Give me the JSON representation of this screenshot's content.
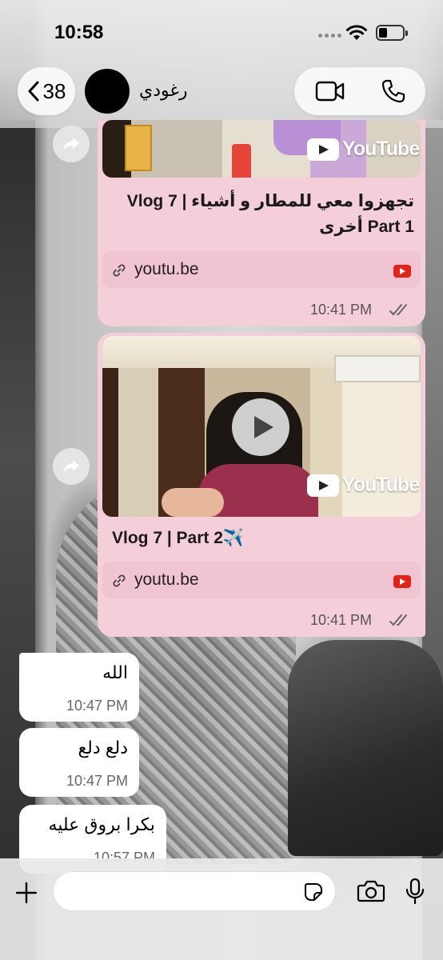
{
  "status_bar": {
    "time": "10:58"
  },
  "header": {
    "back_count": "38",
    "contact_name": "رغودي",
    "video_call_icon": "video-camera-icon",
    "voice_call_icon": "phone-icon"
  },
  "messages": [
    {
      "type": "youtube_link",
      "direction": "outgoing",
      "title": "تجهزوا معي للمطار و أشياء | Vlog 7 Part 1 أخرى",
      "title_line1": "تجهزوا معي للمطار و أشياء | Vlog 7",
      "title_line2": "Part 1 أخرى",
      "thumbnail_brand": "YouTube",
      "link_domain": "youtu.be",
      "time": "10:41 PM",
      "status": "read"
    },
    {
      "type": "youtube_link",
      "direction": "outgoing",
      "title": "Vlog 7 | Part 2✈️",
      "thumbnail_brand": "YouTube",
      "link_domain": "youtu.be",
      "time": "10:41 PM",
      "status": "read"
    },
    {
      "type": "text",
      "direction": "incoming",
      "text": "الله",
      "time": "10:47 PM"
    },
    {
      "type": "text",
      "direction": "incoming",
      "text": "دلع دلع",
      "time": "10:47 PM"
    },
    {
      "type": "text",
      "direction": "incoming",
      "text": "بكرا بروق عليه",
      "time": "10:57 PM"
    }
  ],
  "input_bar": {
    "placeholder": "",
    "plus_icon": "plus-icon",
    "sticker_icon": "sticker-icon",
    "camera_icon": "camera-icon",
    "mic_icon": "microphone-icon"
  },
  "colors": {
    "outgoing_bubble": "#f4cfd9",
    "incoming_bubble": "#ffffff",
    "youtube_red": "#e62117"
  }
}
